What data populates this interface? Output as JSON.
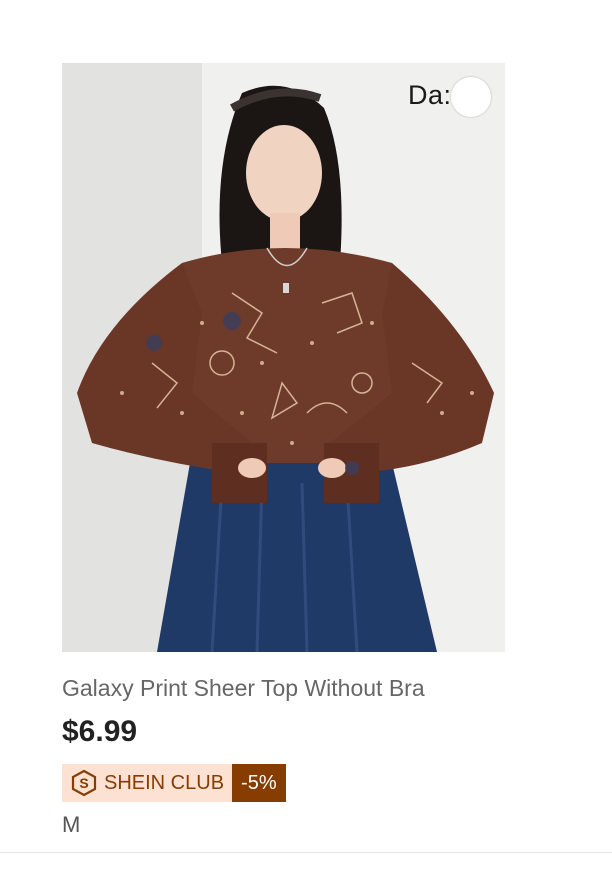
{
  "product": {
    "title": "Galaxy Print Sheer Top Without Bra",
    "price": "$6.99",
    "size": "M",
    "image_alt": "Model wearing brown galaxy print sheer top with denim skirt",
    "watermark": "Da:"
  },
  "club": {
    "label": "SHEIN CLUB",
    "discount": "-5%",
    "icon": "shein-club-icon",
    "badge_bg": "#fde2d3",
    "accent": "#873c00"
  }
}
